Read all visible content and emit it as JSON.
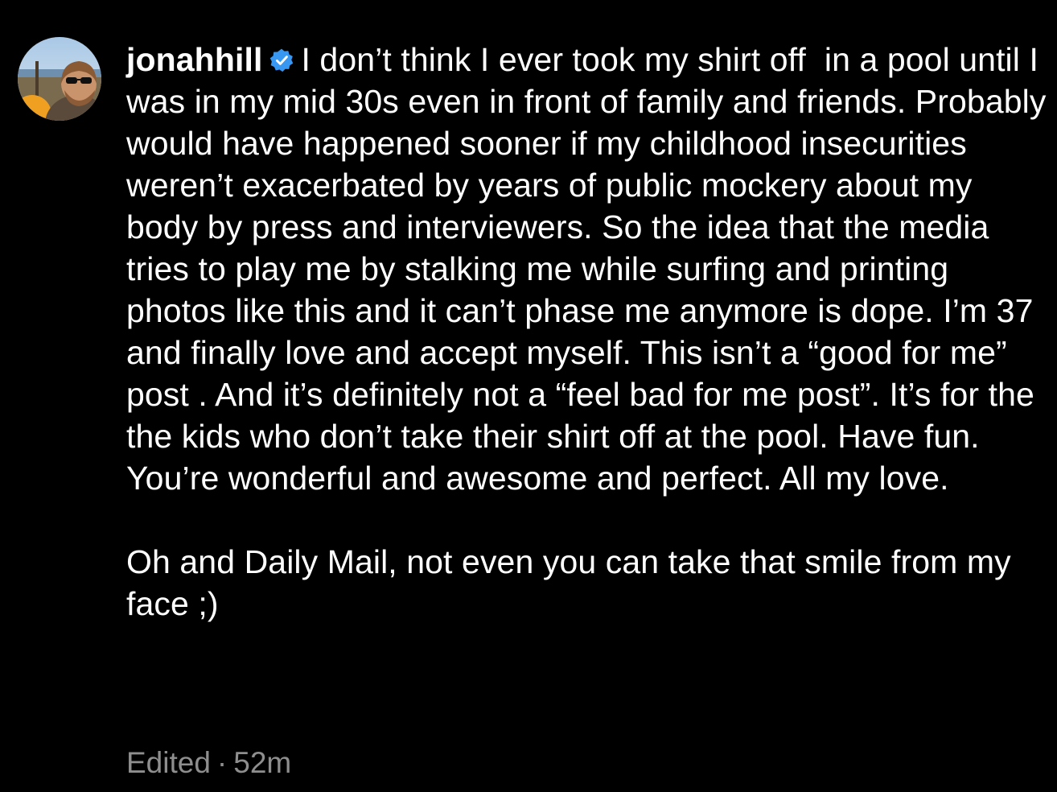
{
  "post": {
    "username": "jonahhill",
    "verified_icon": "verified-badge-icon",
    "caption_paragraph_1": "I don’t think I ever took my shirt off  in a pool until I was in my mid 30s even in front of family and friends. Probably would have happened sooner if my childhood insecurities weren’t exacerbated by years of public mockery about my body by press and interviewers. So the idea that the media tries to play me by stalking me while surfing and printing photos like this and it can’t phase me anymore is dope. I’m 37 and finally love and accept myself. This isn’t a “good for me” post . And it’s definitely not a “feel bad for me post”. It’s for the the kids who don’t take their shirt off at the pool. Have fun. You’re wonderful and awesome and perfect. All my love.",
    "caption_paragraph_2": "Oh and Daily Mail, not even you can take that smile from my face ;)",
    "edited_label": "Edited",
    "separator": "·",
    "time_ago": "52m"
  },
  "colors": {
    "background": "#000000",
    "text": "#ffffff",
    "meta_text": "#8e8e8e",
    "verified_badge": "#3897f0"
  }
}
